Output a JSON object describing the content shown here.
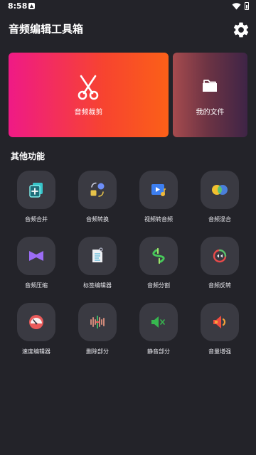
{
  "status": {
    "time": "8:58"
  },
  "app": {
    "title": "音频编辑工具箱"
  },
  "cards": {
    "cut": {
      "label": "音频裁剪"
    },
    "files": {
      "label": "我的文件"
    }
  },
  "section": {
    "title": "其他功能"
  },
  "tools": [
    {
      "label": "音频合并",
      "icon": "audio-merge-icon"
    },
    {
      "label": "音频转换",
      "icon": "audio-convert-icon"
    },
    {
      "label": "视频转音频",
      "icon": "video-to-audio-icon"
    },
    {
      "label": "音频混合",
      "icon": "audio-mix-icon"
    },
    {
      "label": "音频压缩",
      "icon": "audio-compress-icon"
    },
    {
      "label": "标签编辑器",
      "icon": "tag-editor-icon"
    },
    {
      "label": "音频分割",
      "icon": "audio-split-icon"
    },
    {
      "label": "音频反转",
      "icon": "audio-reverse-icon"
    },
    {
      "label": "速度编辑器",
      "icon": "speed-editor-icon"
    },
    {
      "label": "删除部分",
      "icon": "delete-part-icon"
    },
    {
      "label": "静音部分",
      "icon": "mute-part-icon"
    },
    {
      "label": "音量增强",
      "icon": "volume-boost-icon"
    }
  ]
}
